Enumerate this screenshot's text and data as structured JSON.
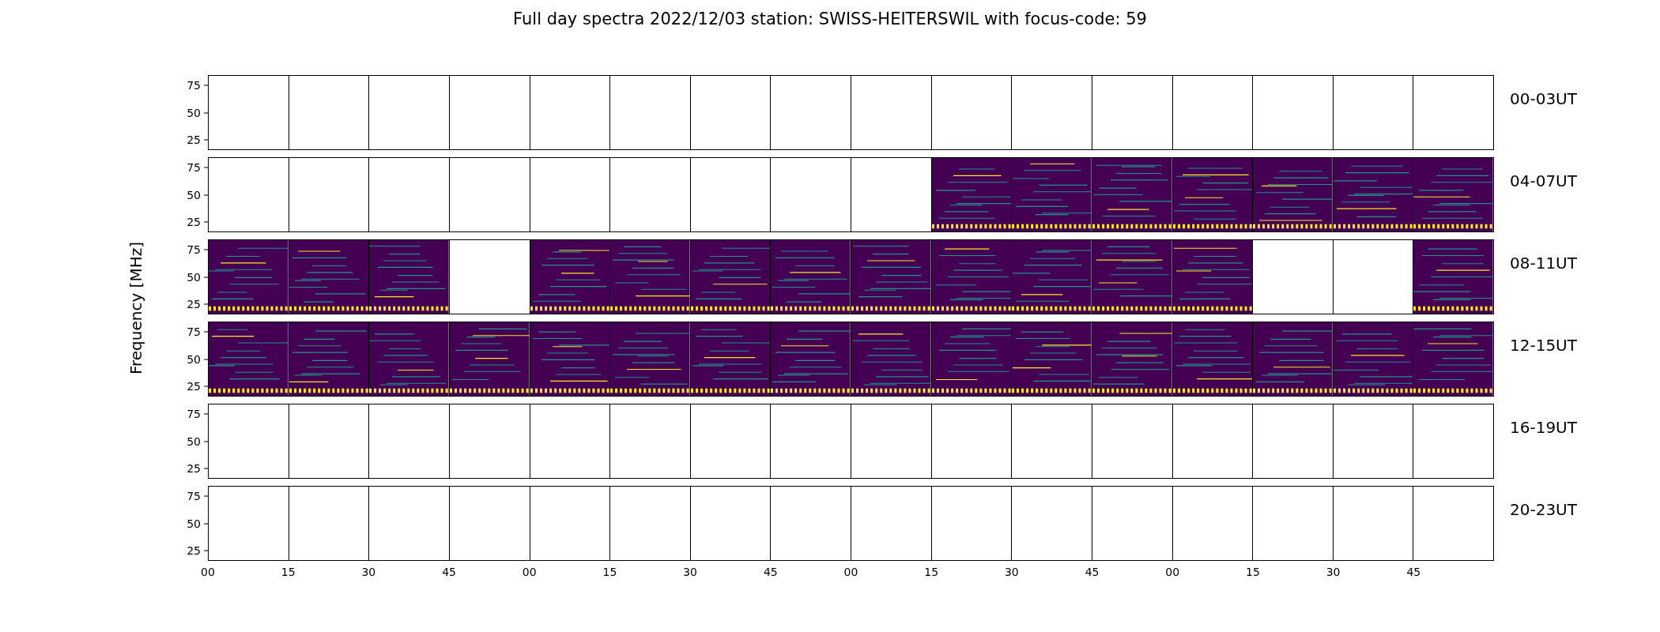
{
  "title": "Full day spectra 2022/12/03 station: SWISS-HEITERSWIL with focus-code: 59",
  "ylabel": "Frequency [MHz]",
  "rows": [
    {
      "label": "00-03UT",
      "yticks": [
        "75",
        "50",
        "25"
      ],
      "panels": [
        {
          "kind": "empty"
        },
        {
          "kind": "empty"
        },
        {
          "kind": "empty"
        },
        {
          "kind": "empty"
        },
        {
          "kind": "empty"
        },
        {
          "kind": "empty"
        },
        {
          "kind": "empty"
        },
        {
          "kind": "empty"
        },
        {
          "kind": "empty"
        },
        {
          "kind": "empty"
        },
        {
          "kind": "empty"
        },
        {
          "kind": "empty"
        },
        {
          "kind": "empty"
        },
        {
          "kind": "empty"
        },
        {
          "kind": "empty"
        },
        {
          "kind": "empty"
        }
      ]
    },
    {
      "label": "04-07UT",
      "yticks": [
        "75",
        "50",
        "25"
      ],
      "panels": [
        {
          "kind": "empty"
        },
        {
          "kind": "empty"
        },
        {
          "kind": "empty"
        },
        {
          "kind": "empty"
        },
        {
          "kind": "empty"
        },
        {
          "kind": "empty"
        },
        {
          "kind": "empty"
        },
        {
          "kind": "empty"
        },
        {
          "kind": "empty"
        },
        {
          "kind": "spectrogram"
        },
        {
          "kind": "spectrogram"
        },
        {
          "kind": "spectrogram"
        },
        {
          "kind": "spectrogram"
        },
        {
          "kind": "spectrogram"
        },
        {
          "kind": "spectrogram"
        },
        {
          "kind": "spectrogram"
        }
      ]
    },
    {
      "label": "08-11UT",
      "yticks": [
        "75",
        "50",
        "25"
      ],
      "panels": [
        {
          "kind": "spectrogram"
        },
        {
          "kind": "spectrogram"
        },
        {
          "kind": "spectrogram"
        },
        {
          "kind": "empty"
        },
        {
          "kind": "spectrogram"
        },
        {
          "kind": "spectrogram"
        },
        {
          "kind": "spectrogram"
        },
        {
          "kind": "spectrogram"
        },
        {
          "kind": "spectrogram"
        },
        {
          "kind": "spectrogram"
        },
        {
          "kind": "spectrogram"
        },
        {
          "kind": "spectrogram"
        },
        {
          "kind": "spectrogram"
        },
        {
          "kind": "empty"
        },
        {
          "kind": "empty"
        },
        {
          "kind": "spectrogram"
        }
      ]
    },
    {
      "label": "12-15UT",
      "yticks": [
        "75",
        "50",
        "25"
      ],
      "panels": [
        {
          "kind": "spectrogram"
        },
        {
          "kind": "spectrogram"
        },
        {
          "kind": "spectrogram"
        },
        {
          "kind": "spectrogram"
        },
        {
          "kind": "spectrogram"
        },
        {
          "kind": "spectrogram"
        },
        {
          "kind": "spectrogram"
        },
        {
          "kind": "spectrogram"
        },
        {
          "kind": "spectrogram"
        },
        {
          "kind": "spectrogram"
        },
        {
          "kind": "spectrogram"
        },
        {
          "kind": "spectrogram"
        },
        {
          "kind": "spectrogram"
        },
        {
          "kind": "spectrogram"
        },
        {
          "kind": "spectrogram"
        },
        {
          "kind": "spectrogram"
        }
      ]
    },
    {
      "label": "16-19UT",
      "yticks": [
        "75",
        "50",
        "25"
      ],
      "panels": [
        {
          "kind": "empty"
        },
        {
          "kind": "empty"
        },
        {
          "kind": "empty"
        },
        {
          "kind": "empty"
        },
        {
          "kind": "empty"
        },
        {
          "kind": "empty"
        },
        {
          "kind": "empty"
        },
        {
          "kind": "empty"
        },
        {
          "kind": "empty"
        },
        {
          "kind": "empty"
        },
        {
          "kind": "empty"
        },
        {
          "kind": "empty"
        },
        {
          "kind": "empty"
        },
        {
          "kind": "empty"
        },
        {
          "kind": "empty"
        },
        {
          "kind": "empty"
        }
      ]
    },
    {
      "label": "20-23UT",
      "yticks": [
        "75",
        "50",
        "25"
      ],
      "panels": [
        {
          "kind": "empty"
        },
        {
          "kind": "empty"
        },
        {
          "kind": "empty"
        },
        {
          "kind": "empty"
        },
        {
          "kind": "empty"
        },
        {
          "kind": "empty"
        },
        {
          "kind": "empty"
        },
        {
          "kind": "empty"
        },
        {
          "kind": "empty"
        },
        {
          "kind": "empty"
        },
        {
          "kind": "empty"
        },
        {
          "kind": "empty"
        },
        {
          "kind": "empty"
        },
        {
          "kind": "empty"
        },
        {
          "kind": "empty"
        },
        {
          "kind": "empty"
        }
      ]
    }
  ],
  "xticks": [
    "00",
    "15",
    "30",
    "45",
    "00",
    "15",
    "30",
    "45",
    "00",
    "15",
    "30",
    "45",
    "00",
    "15",
    "30",
    "45"
  ]
}
